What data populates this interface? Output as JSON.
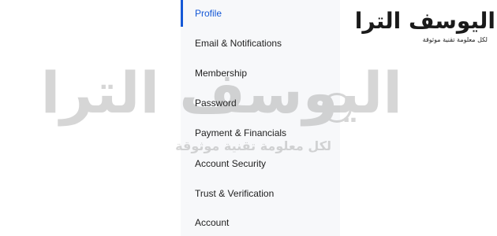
{
  "settings_nav": {
    "items": [
      {
        "label": "Profile",
        "active": true
      },
      {
        "label": "Email & Notifications",
        "active": false
      },
      {
        "label": "Membership",
        "active": false
      },
      {
        "label": "Password",
        "active": false
      },
      {
        "label": "Payment & Financials",
        "active": false
      },
      {
        "label": "Account Security",
        "active": false
      },
      {
        "label": "Trust & Verification",
        "active": false
      },
      {
        "label": "Account",
        "active": false
      }
    ],
    "active_color": "#1558d6"
  },
  "watermark": {
    "title": "اليوسف الترا",
    "subtitle": "لكل معلومة تقنية موثوقة"
  }
}
